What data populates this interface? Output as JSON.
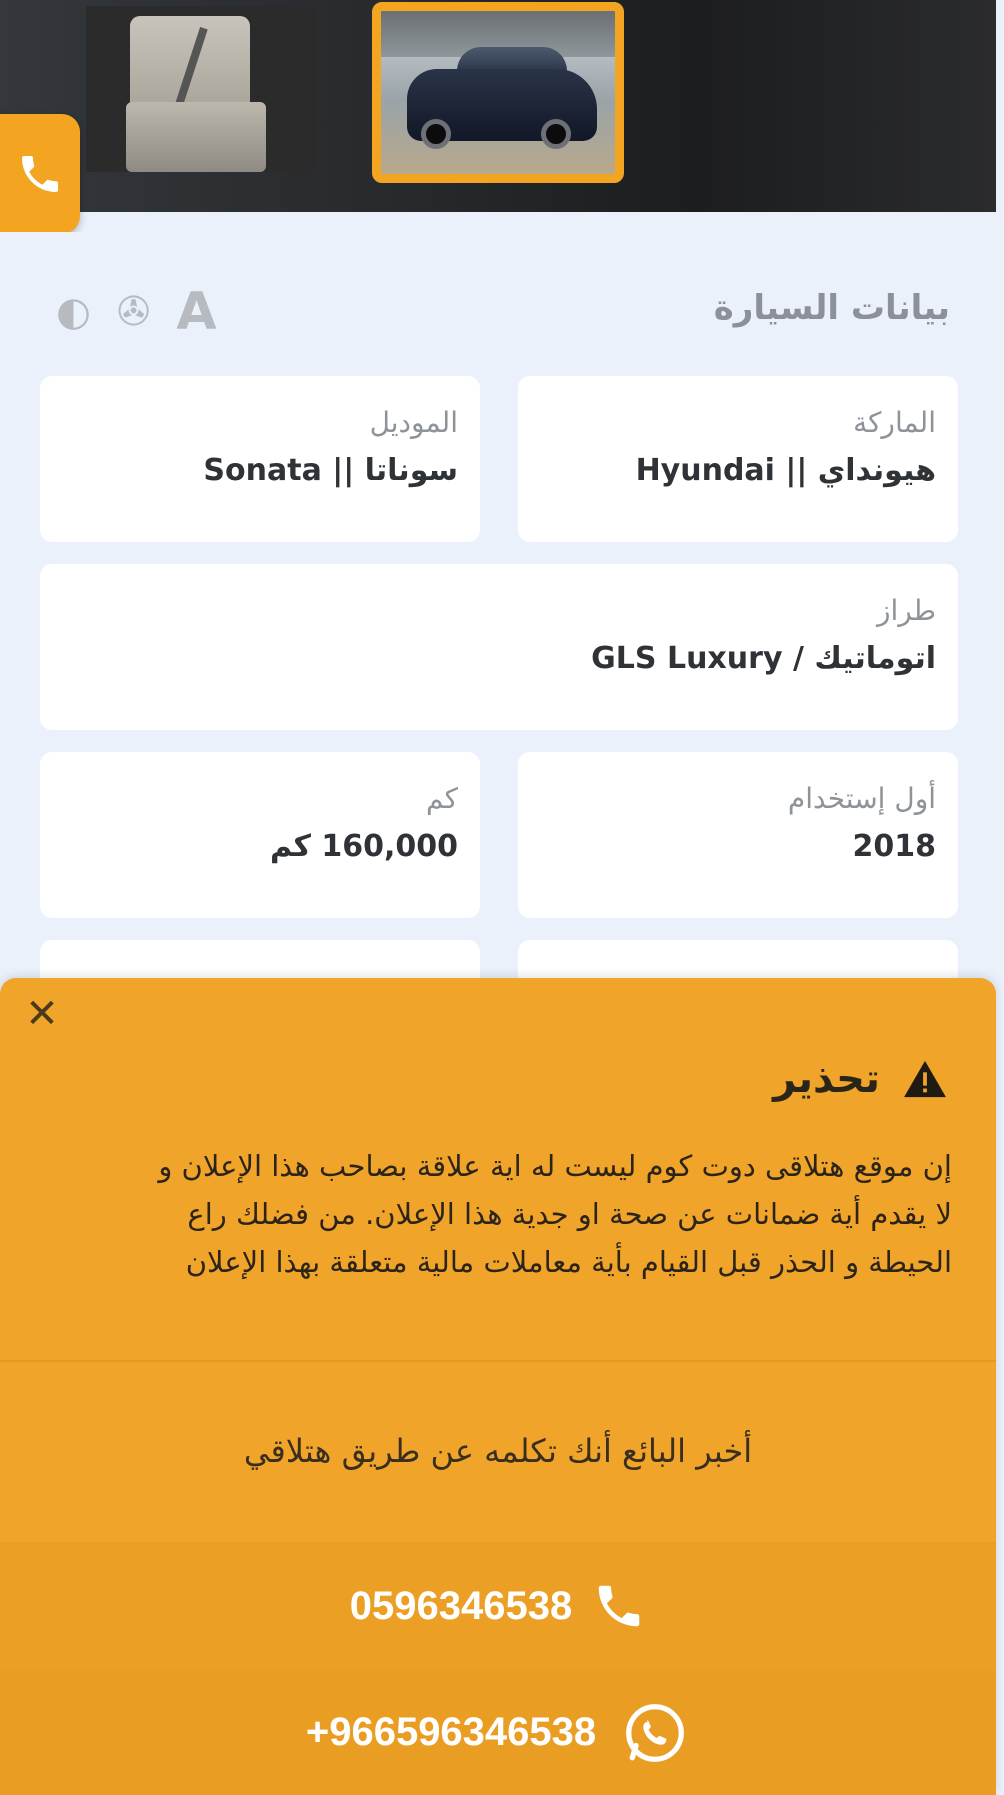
{
  "gallery": {
    "thumbnails": [
      {
        "name": "rear-seat-photo"
      },
      {
        "name": "front-exterior-photo",
        "selected": true
      }
    ],
    "selected_border_color": "#f3a521"
  },
  "floating_actions": {
    "call_icon": "phone-icon",
    "whatsapp_icon": "whatsapp-icon",
    "share_icon": "share-icon",
    "call_color": "#f3a521",
    "whatsapp_color": "#35b73f",
    "share_color": "#3d3f42"
  },
  "car_details": {
    "title": "بيانات السيارة",
    "spec_icons": [
      "automatic-transmission-icon",
      "ac-fan-icon",
      "extra-feature-icon"
    ],
    "brand": {
      "label": "الماركة",
      "value": "هيونداي || Hyundai"
    },
    "model": {
      "label": "الموديل",
      "value": "سوناتا || Sonata"
    },
    "trim": {
      "label": "طراز",
      "value": "اتوماتيك / GLS Luxury"
    },
    "first_use": {
      "label": "أول إستخدام",
      "value": "2018"
    },
    "mileage": {
      "label": "كم",
      "value": "160,000 كم"
    }
  },
  "warning": {
    "close_icon": "close-icon",
    "title": "تحذير",
    "body_lines": [
      "إن موقع هتلاقى دوت كوم ليست له اية علاقة بصاحب هذا الإعلان و",
      "لا يقدم أية ضمانات عن صحة او جدية هذا الإعلان. من فضلك راع",
      "الحيطة و الحذر قبل القيام بأية معاملات مالية متعلقة بهذا الإعلان"
    ],
    "tell_seller": "أخبر البائع أنك تكلمه عن طريق هتلاقي",
    "phone_number": "0596346538",
    "whatsapp_number": "+966596346538",
    "accent": "#f0a42a"
  }
}
